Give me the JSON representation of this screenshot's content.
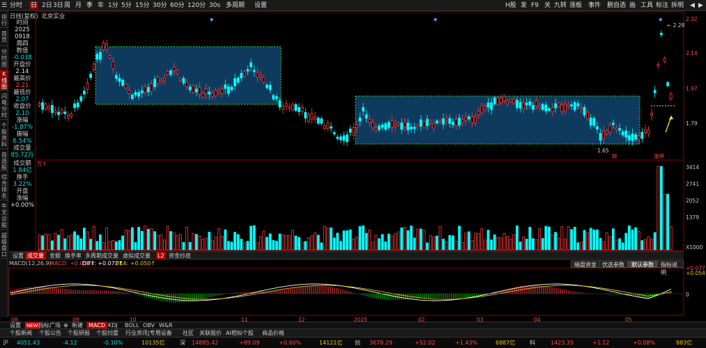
{
  "toolbar": {
    "items": [
      "分时",
      "日",
      "2日",
      "3日",
      "周",
      "月",
      "季",
      "年",
      "1分",
      "5分",
      "15分",
      "30分",
      "60分",
      "120分",
      "30s",
      "多周期",
      "设置"
    ],
    "right_items": [
      "H股",
      "发",
      "F9",
      "关",
      "九转",
      "涨板",
      "事件",
      "删自选",
      "画",
      "工具",
      "标注",
      "拆明"
    ]
  },
  "left_tabs": [
    "排行",
    "首页",
    "分时图",
    "K线图",
    "闪电分时",
    "个股资料",
    "自选股",
    "综合排名",
    "牛叉诊股",
    "超级盘口"
  ],
  "stock": {
    "title": "日线(复权)",
    "name": "北京实业"
  },
  "info": {
    "time_label": "时间",
    "year": "2025",
    "date": "0918",
    "weekday": "周四",
    "value_label": "数值",
    "value": "-0.038",
    "open_label": "开盘价",
    "open": "2.14",
    "high_label": "最高价",
    "high": "2.21",
    "low_label": "最低价",
    "low": "2.07",
    "close_label": "收盘价",
    "close": "2.10",
    "change_label": "涨幅",
    "change": "-1.87%",
    "amp_label": "振幅",
    "amp": "6.54%",
    "volume_label": "成交量",
    "volume": "85.72万",
    "amount_label": "成交额",
    "amount": "1.84亿",
    "turnover_label": "换手",
    "turnover": "3.22%",
    "open2_label": "开盘",
    "chg2_label": "涨幅",
    "chg2": "+0.00%"
  },
  "price_axis": [
    "2.32",
    "2.14",
    "1.97",
    "1.79"
  ],
  "price_markers": {
    "high": "2.28",
    "low": "1.65",
    "tag1": "财",
    "tag2": "涨停"
  },
  "volume_axis": [
    "3414",
    "2741",
    "2052",
    "1379",
    "X1000"
  ],
  "volume_unit": "万",
  "vol_tabs": [
    "设置",
    "成交量",
    "金额",
    "换手率",
    "多周期成交量",
    "虚拟成交量",
    "资金抄底"
  ],
  "vol_tabs_badge": "L2",
  "macd_buttons": [
    "暗盘资金",
    "优选参数",
    "默认参数",
    "指标说明"
  ],
  "macd_label": {
    "name": "MACD(12,26,9)",
    "macd": "MACD: +0.054↓",
    "diff": "DIFF: +0.077↑",
    "dea": "DEA: +0.050↑"
  },
  "macd_axis": [
    "+0.077",
    "+0.054",
    "0"
  ],
  "x_axis": [
    "08",
    "09",
    "10",
    "11",
    "12",
    "2025",
    "02",
    "03",
    "04",
    "05"
  ],
  "indicator_bar": [
    "设置",
    "NEW",
    "指标广场",
    "新建",
    "MACD",
    "KDJ",
    "BOLL",
    "OBV",
    "W&R"
  ],
  "info_bar": [
    "个股新闻",
    "个股公告",
    "个股研报",
    "个股扫雷",
    "行业资讯|专用设备",
    "社区",
    "关联报价",
    "AI相似个股",
    "商品价格"
  ],
  "indices": [
    {
      "name": "沪",
      "value": "4051.43",
      "chg": "-4.12",
      "pct": "-0.10%",
      "amount": "10135亿"
    },
    {
      "name": "深",
      "value": "14885.42",
      "chg": "+89.09",
      "pct": "+0.60%",
      "amount": "14121亿"
    },
    {
      "name": "创",
      "value": "3678.29",
      "chg": "+52.02",
      "pct": "+1.43%",
      "amount": "6887亿"
    },
    {
      "name": "科",
      "value": "1423.35",
      "chg": "+1.12",
      "pct": "+0.08%",
      "amount": "883亿"
    }
  ],
  "colors": {
    "up": "#ff3b3b",
    "down": "#00ffff",
    "bg": "#000000",
    "box_fill": "#0e3a5e",
    "box_border": "#22dd22"
  }
}
